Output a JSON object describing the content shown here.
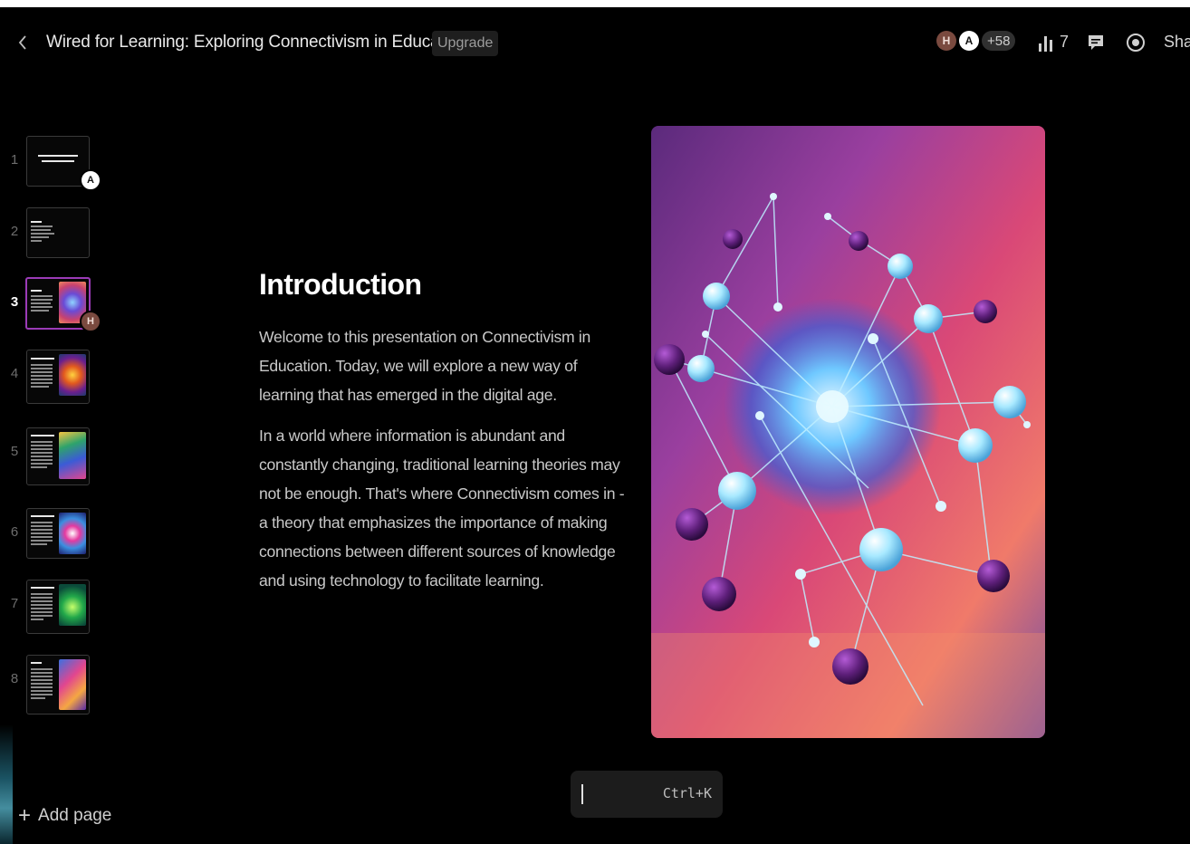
{
  "header": {
    "title": "Wired for Learning: Exploring Connectivism in Education",
    "upgrade_label": "Upgrade",
    "collaborators": [
      "H",
      "A"
    ],
    "collaborators_more": "+58",
    "views_count": "7",
    "share_label": "Sha"
  },
  "sidebar": {
    "thumbnails": [
      {
        "number": "1",
        "cursor": "A"
      },
      {
        "number": "2"
      },
      {
        "number": "3",
        "cursor": "H",
        "active": true
      },
      {
        "number": "4"
      },
      {
        "number": "5"
      },
      {
        "number": "6"
      },
      {
        "number": "7"
      },
      {
        "number": "8"
      }
    ],
    "add_page_label": "Add page"
  },
  "slide": {
    "title": "Introduction",
    "paragraphs": [
      "Welcome to this presentation on Connectivism in Education. Today, we will explore a new way of learning that has emerged in the digital age.",
      "In a world where information is abundant and constantly changing, traditional learning theories may not be enough. That's where Connectivism comes in - a theory that emphasizes the importance of making connections between different sources of knowledge and using technology to facilitate learning."
    ]
  },
  "command_bar": {
    "shortcut": "Ctrl+K"
  },
  "colors": {
    "background": "#000000",
    "active_thumb_border": "#9b3bb7",
    "upgrade_bg": "#1e1e1e"
  }
}
